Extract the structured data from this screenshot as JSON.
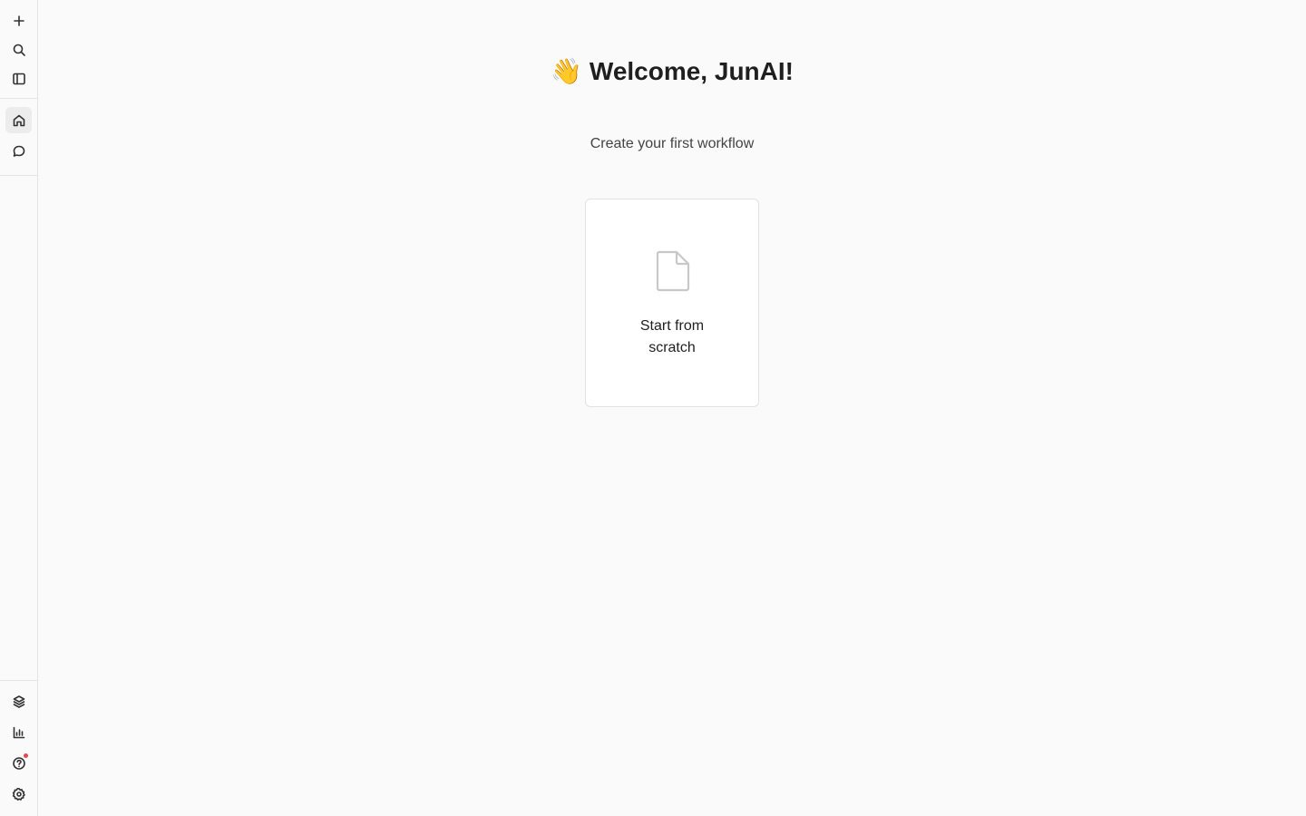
{
  "header": {
    "wave_emoji": "👋",
    "welcome_text": "Welcome, JunAI!",
    "subtitle": "Create your first workflow"
  },
  "cards": [
    {
      "label": "Start from\nscratch",
      "icon": "file-icon"
    }
  ],
  "sidebar": {
    "top_items": [
      {
        "name": "new",
        "icon": "plus-icon"
      },
      {
        "name": "search",
        "icon": "search-icon"
      },
      {
        "name": "toggle-sidebar",
        "icon": "sidebar-panel-icon"
      }
    ],
    "nav_items": [
      {
        "name": "home",
        "icon": "home-icon",
        "active": true
      },
      {
        "name": "chat",
        "icon": "chat-bubble-icon",
        "active": false
      }
    ],
    "bottom_items": [
      {
        "name": "integrations",
        "icon": "layers-icon"
      },
      {
        "name": "analytics",
        "icon": "bar-chart-icon"
      },
      {
        "name": "help",
        "icon": "help-circle-icon",
        "notification": true
      },
      {
        "name": "settings",
        "icon": "gear-icon"
      }
    ]
  },
  "colors": {
    "background": "#fafafa",
    "notification_dot": "#e5484d",
    "active_item_bg": "#ececec"
  }
}
